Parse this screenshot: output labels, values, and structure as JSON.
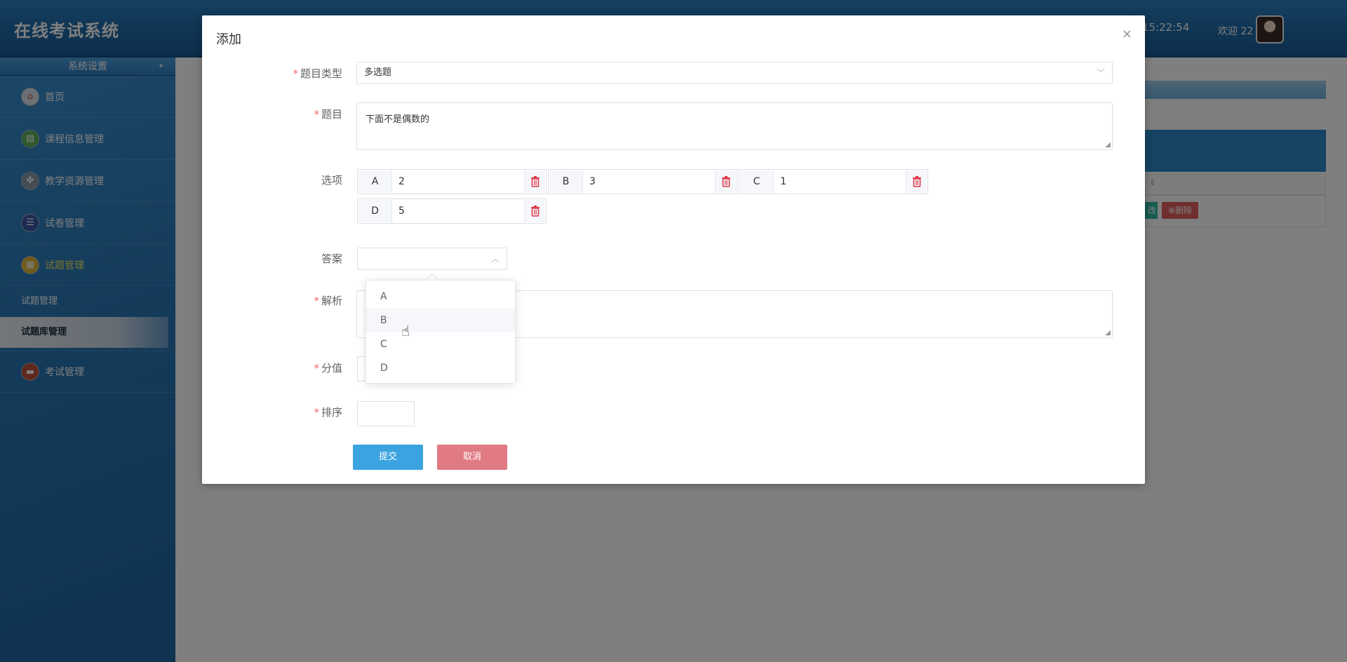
{
  "app": {
    "title": "在线考试系统",
    "clock": "15:22:54",
    "welcome": "欢迎 22"
  },
  "sidebar": {
    "header": "系统设置",
    "items": [
      {
        "label": "首页",
        "icon": "home-icon"
      },
      {
        "label": "课程信息管理",
        "icon": "course-icon"
      },
      {
        "label": "教学资源管理",
        "icon": "resource-icon"
      },
      {
        "label": "试卷管理",
        "icon": "paper-icon"
      },
      {
        "label": "试题管理",
        "icon": "question-icon"
      }
    ],
    "submenu": [
      {
        "label": "试题管理"
      },
      {
        "label": "试题库管理"
      }
    ],
    "exam_item": {
      "label": "考试管理",
      "icon": "exam-icon"
    }
  },
  "background_table": {
    "edit_partial": "改",
    "delete_label": "删除"
  },
  "dialog": {
    "title": "添加",
    "close": "×",
    "fields": {
      "type_label": "题目类型",
      "type_value": "多选题",
      "question_label": "题目",
      "question_value": "下面不是偶数的",
      "options_label": "选项",
      "answer_label": "答案",
      "analysis_label": "解析",
      "score_label": "分值",
      "order_label": "排序"
    },
    "options": [
      {
        "letter": "A",
        "value": "2"
      },
      {
        "letter": "B",
        "value": "3"
      },
      {
        "letter": "C",
        "value": "1"
      },
      {
        "letter": "D",
        "value": "5"
      }
    ],
    "submit_label": "提交",
    "cancel_label": "取消"
  },
  "answer_dropdown": {
    "options": [
      "A",
      "B",
      "C",
      "D"
    ],
    "hovered": "B"
  },
  "colors": {
    "primary": "#3aa3e0",
    "danger": "#e07a83",
    "required": "#f56c6c",
    "delete_icon": "#e0394a"
  }
}
